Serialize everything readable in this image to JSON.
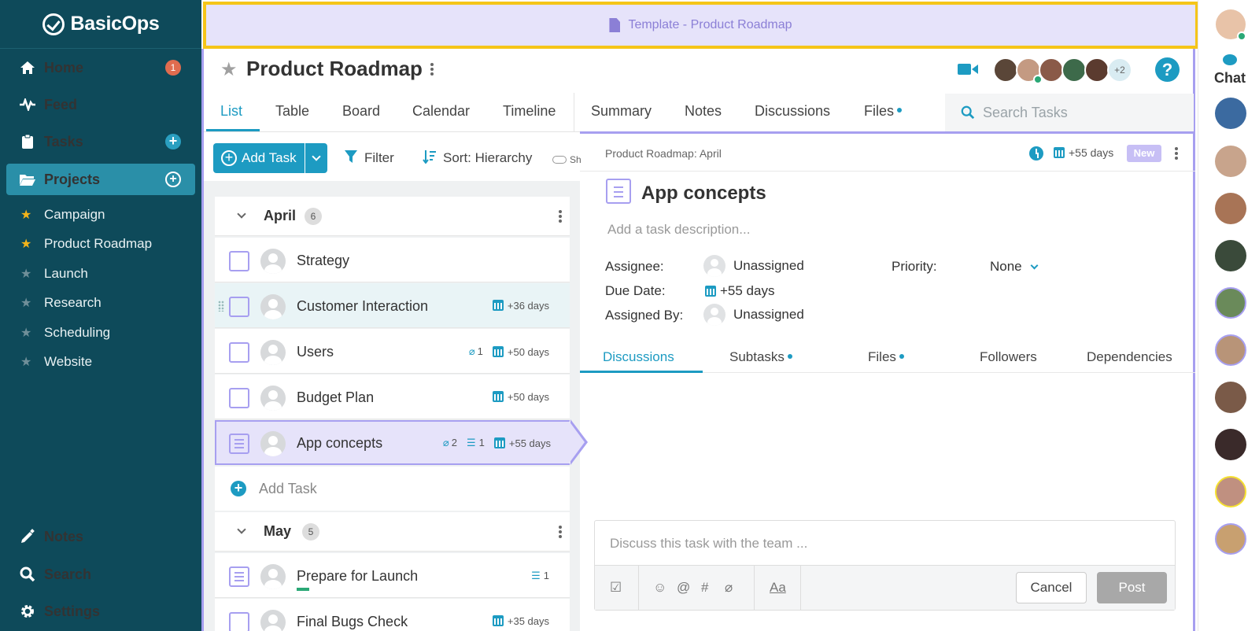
{
  "app": {
    "name": "BasicOps"
  },
  "sidebar": {
    "nav": [
      {
        "label": "Home",
        "icon": "home-icon",
        "badge": "1"
      },
      {
        "label": "Feed",
        "icon": "pulse-icon"
      },
      {
        "label": "Tasks",
        "icon": "clipboard-icon"
      },
      {
        "label": "Projects",
        "icon": "folder-icon"
      }
    ],
    "projects": [
      {
        "label": "Campaign",
        "favorite": true
      },
      {
        "label": "Product Roadmap",
        "favorite": true
      },
      {
        "label": "Launch",
        "favorite": false
      },
      {
        "label": "Research",
        "favorite": false
      },
      {
        "label": "Scheduling",
        "favorite": false
      },
      {
        "label": "Website",
        "favorite": false
      }
    ],
    "bottom": [
      {
        "label": "Notes",
        "icon": "pencil-icon"
      },
      {
        "label": "Search",
        "icon": "search-icon"
      },
      {
        "label": "Settings",
        "icon": "gear-icon"
      }
    ]
  },
  "banner": {
    "label": "Template - Product Roadmap"
  },
  "header": {
    "title": "Product Roadmap",
    "extra_members": "+2"
  },
  "tabs": {
    "left": [
      "List",
      "Table",
      "Board",
      "Calendar",
      "Timeline"
    ],
    "right": [
      "Summary",
      "Notes",
      "Discussions",
      "Files"
    ],
    "search_placeholder": "Search Tasks"
  },
  "toolbar": {
    "add_task": "Add Task",
    "filter": "Filter",
    "sort": "Sort: Hierarchy",
    "show": "Sh"
  },
  "groups": [
    {
      "name": "April",
      "count": "6",
      "tasks": [
        {
          "name": "Strategy"
        },
        {
          "name": "Customer Interaction",
          "due": "+36 days"
        },
        {
          "name": "Users",
          "attachments": "1",
          "due": "+50 days"
        },
        {
          "name": "Budget Plan",
          "due": "+50 days"
        },
        {
          "name": "App concepts",
          "attachments": "2",
          "subtasks": "1",
          "due": "+55 days"
        }
      ],
      "add_label": "Add Task"
    },
    {
      "name": "May",
      "count": "5",
      "tasks": [
        {
          "name": "Prepare for Launch",
          "subtasks": "1"
        },
        {
          "name": "Final Bugs Check",
          "due": "+35 days"
        }
      ]
    }
  ],
  "detail": {
    "breadcrumb": "Product Roadmap: April",
    "due_short": "+55 days",
    "badge": "New",
    "title": "App concepts",
    "description_placeholder": "Add a task description...",
    "fields": {
      "assignee_label": "Assignee:",
      "assignee": "Unassigned",
      "due_label": "Due Date:",
      "due": "+55 days",
      "assigned_by_label": "Assigned By:",
      "assigned_by": "Unassigned",
      "priority_label": "Priority:",
      "priority": "None"
    },
    "tabs": [
      "Discussions",
      "Subtasks",
      "Files",
      "Followers",
      "Dependencies"
    ],
    "comment_placeholder": "Discuss this task with the team ...",
    "cancel": "Cancel",
    "post": "Post"
  },
  "chat": {
    "label": "Chat"
  },
  "colors": {
    "sidebar": "#0e4a5a",
    "accent": "#1d9bc2",
    "purple": "#a79ff0",
    "banner_border": "#f5c518"
  }
}
